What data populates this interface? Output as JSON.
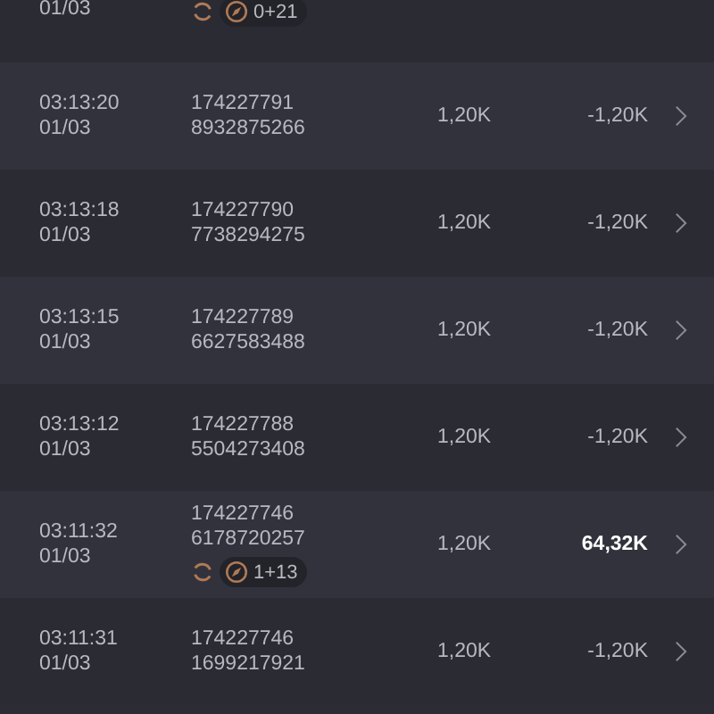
{
  "rows": [
    {
      "date": "01/03",
      "badge": "0+21"
    },
    {
      "time": "03:13:20",
      "date": "01/03",
      "ids": [
        "174227791",
        "8932875266"
      ],
      "stake": "1,20K",
      "result": "-1,20K",
      "highlight": false
    },
    {
      "time": "03:13:18",
      "date": "01/03",
      "ids": [
        "174227790",
        "7738294275"
      ],
      "stake": "1,20K",
      "result": "-1,20K",
      "highlight": false
    },
    {
      "time": "03:13:15",
      "date": "01/03",
      "ids": [
        "174227789",
        "6627583488"
      ],
      "stake": "1,20K",
      "result": "-1,20K",
      "highlight": false
    },
    {
      "time": "03:13:12",
      "date": "01/03",
      "ids": [
        "174227788",
        "5504273408"
      ],
      "stake": "1,20K",
      "result": "-1,20K",
      "highlight": false
    },
    {
      "time": "03:11:32",
      "date": "01/03",
      "ids": [
        "174227746",
        "6178720257"
      ],
      "badge": "1+13",
      "stake": "1,20K",
      "result": "64,32K",
      "highlight": true
    },
    {
      "time": "03:11:31",
      "date": "01/03",
      "ids": [
        "174227746",
        "1699217921"
      ],
      "stake": "1,20K",
      "result": "-1,20K",
      "highlight": false
    }
  ]
}
